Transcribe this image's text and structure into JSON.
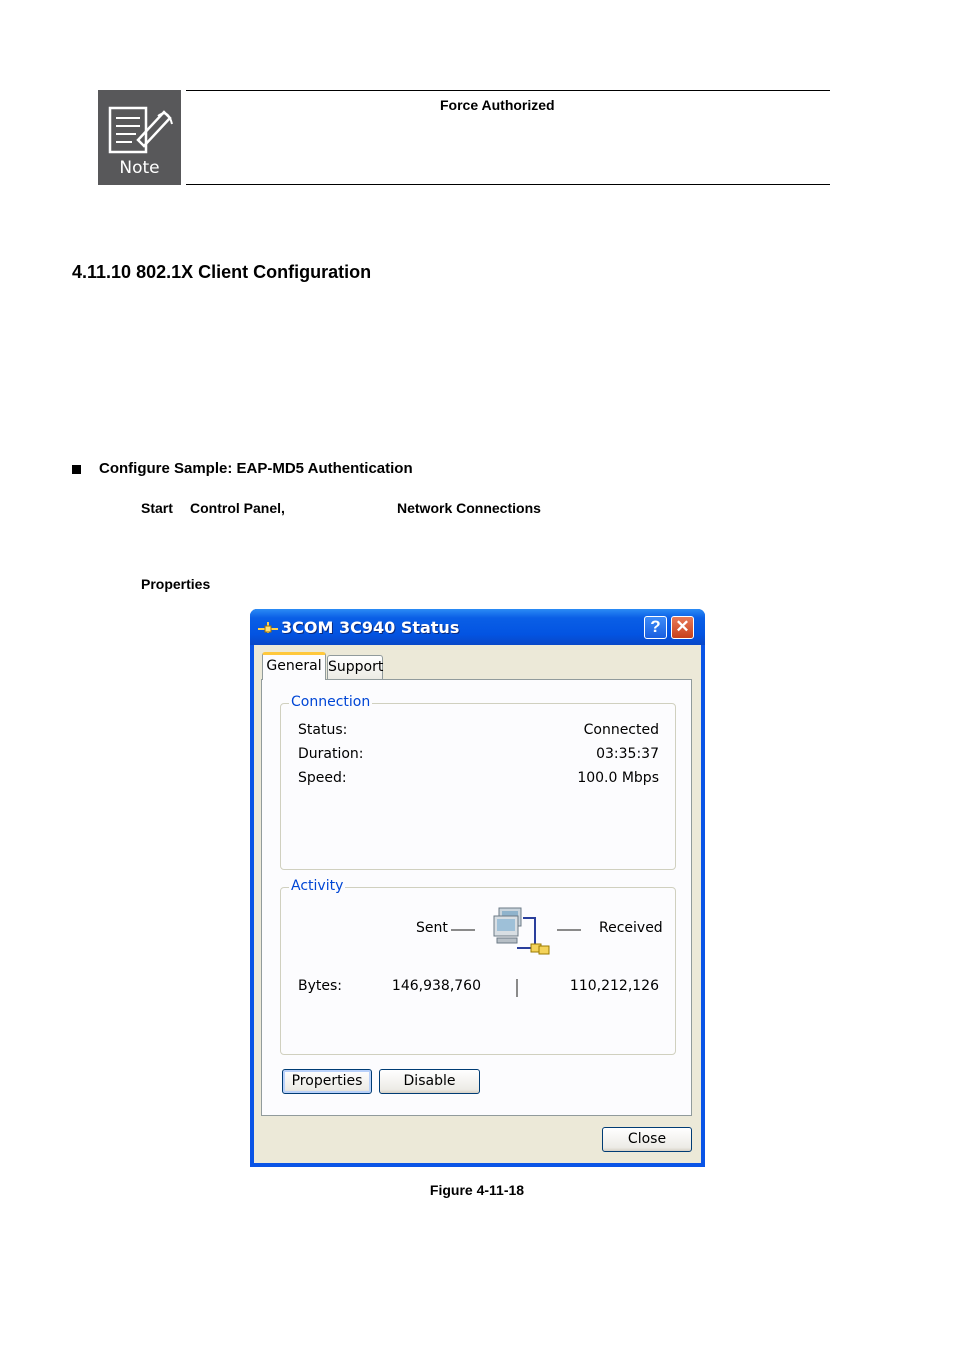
{
  "note": {
    "icon_label": "Note",
    "text": "Force Authorized"
  },
  "section": {
    "title": "4.11.10 802.1X Client Configuration"
  },
  "bullet": {
    "text": "Configure Sample: EAP-MD5 Authentication"
  },
  "steps": {
    "start": "Start",
    "control_panel": "Control Panel,",
    "network_connections": "Network Connections",
    "properties": "Properties"
  },
  "window": {
    "title": "3COM 3C940 Status",
    "tabs": [
      {
        "label": "General",
        "active": true
      },
      {
        "label": "Support",
        "active": false
      }
    ],
    "connection": {
      "label": "Connection",
      "rows": [
        {
          "key": "Status:",
          "value": "Connected"
        },
        {
          "key": "Duration:",
          "value": "03:35:37"
        },
        {
          "key": "Speed:",
          "value": "100.0 Mbps"
        }
      ]
    },
    "activity": {
      "label": "Activity",
      "sent_label": "Sent",
      "received_label": "Received",
      "bytes_label": "Bytes:",
      "bytes_sent": "146,938,760",
      "bytes_received": "110,212,126"
    },
    "buttons": {
      "properties": "Properties",
      "disable": "Disable",
      "close": "Close"
    }
  },
  "caption": "Figure 4-11-18"
}
